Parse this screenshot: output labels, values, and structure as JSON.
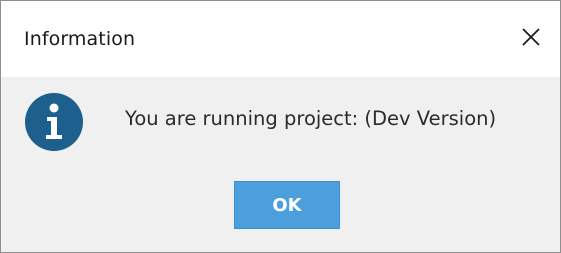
{
  "window": {
    "title": "Information",
    "close_icon": "close-icon"
  },
  "dialog": {
    "icon": "info-icon",
    "icon_color": "#1d5f8d",
    "message": "You are running project: (Dev Version)",
    "ok_label": "OK",
    "ok_button_color": "#4a9fdc",
    "content_background": "#f0f0f0"
  }
}
